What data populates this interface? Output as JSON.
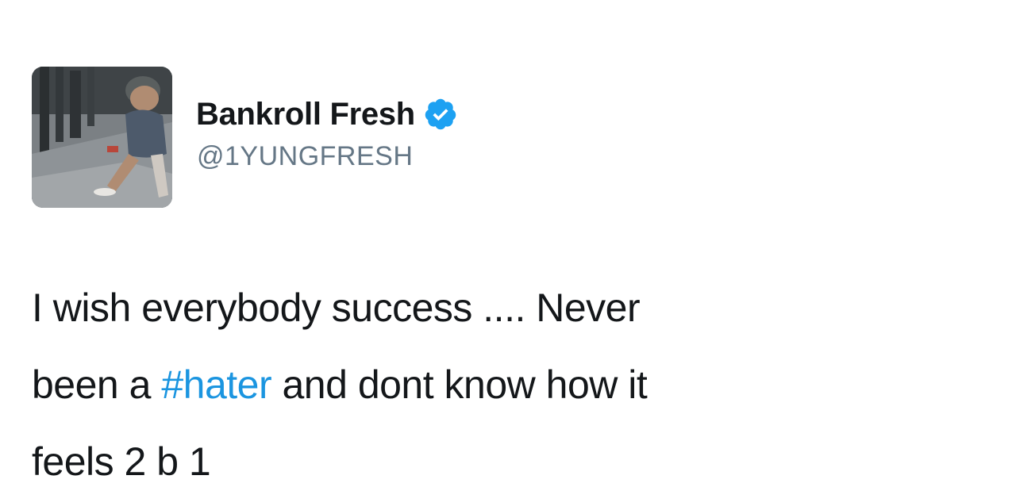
{
  "tweet": {
    "author": {
      "display_name": "Bankroll Fresh",
      "handle": "@1YUNGFRESH",
      "verified": true
    },
    "text": {
      "line1": "I wish everybody success .... Never",
      "line2_before": "been a ",
      "hashtag": "#hater",
      "line2_after": " and dont know how it",
      "line3": "feels 2 b 1"
    },
    "colors": {
      "hashtag": "#1b95e0",
      "verified_badge": "#1da1f2",
      "handle": "#657786",
      "text": "#14171a"
    }
  }
}
